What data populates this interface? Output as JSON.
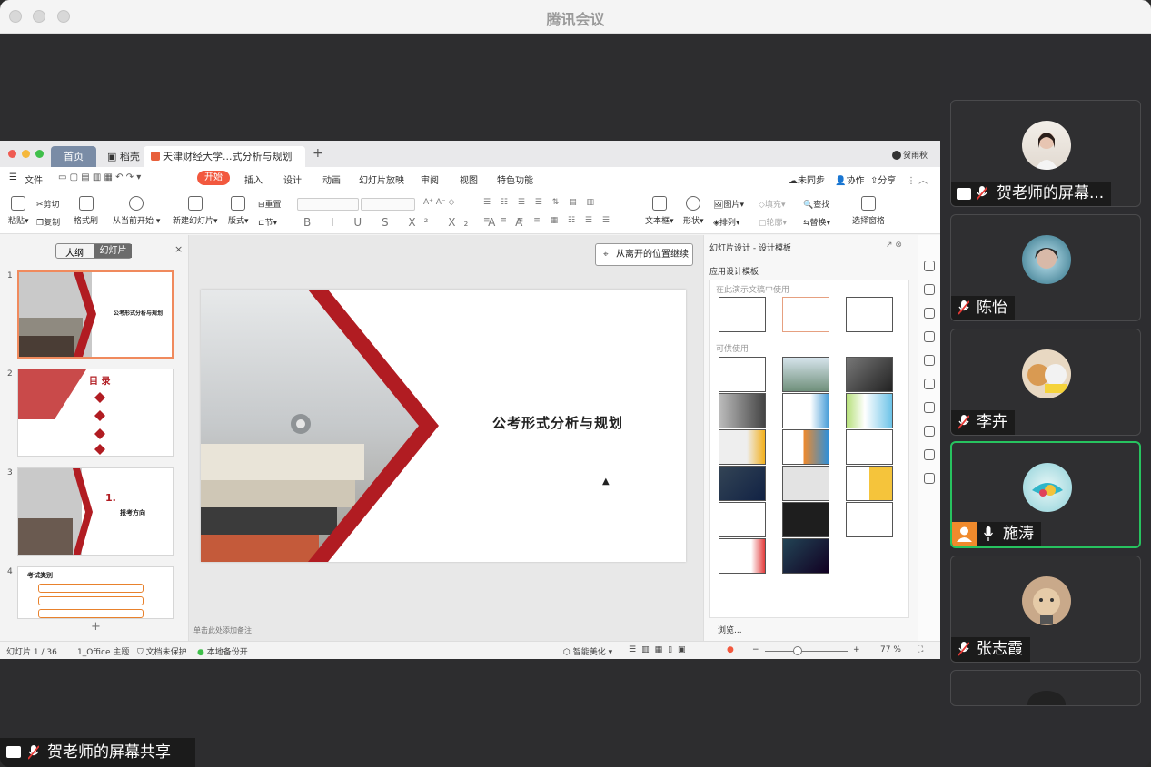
{
  "app": {
    "title": "腾讯会议"
  },
  "wps": {
    "tabs": {
      "home": "首页",
      "daoke": "稻壳",
      "doc": "天津财经大学...式分析与规划",
      "add": "+"
    },
    "user": "贺雨秋",
    "menu": {
      "file": "文件",
      "start": "开始",
      "insert": "插入",
      "design": "设计",
      "animation": "动画",
      "slideshow": "幻灯片放映",
      "review": "审阅",
      "view": "视图",
      "special": "特色功能",
      "unsynced": "未同步",
      "collab": "协作",
      "share": "分享"
    },
    "ribbon": {
      "paste": "粘贴",
      "cut": "剪切",
      "copy": "复制",
      "format_painter": "格式刷",
      "play_from_current": "从当前开始",
      "new_slide": "新建幻灯片",
      "layout": "版式",
      "reset": "重置",
      "section": "节",
      "textbox": "文本框",
      "shape": "形状",
      "picture": "图片",
      "arrange": "排列",
      "fill": "填充",
      "outline": "轮廓",
      "find": "查找",
      "replace": "替换",
      "select_pane": "选择窗格"
    },
    "left_panel": {
      "outline": "大纲",
      "slides": "幻灯片",
      "close": "×",
      "add": "+",
      "thumbs": [
        {
          "num": "1",
          "title": "公考形式分析与规划"
        },
        {
          "num": "2",
          "title": "目 录"
        },
        {
          "num": "3",
          "heading": "1.",
          "title": "报考方向"
        },
        {
          "num": "4",
          "title": "考试类别"
        }
      ]
    },
    "slide": {
      "title": "公考形式分析与规划",
      "resume": "从离开的位置继续"
    },
    "notes": "单击此处添加备注",
    "design_panel": {
      "title": "幻灯片设计 - 设计模板",
      "apply": "应用设计模板",
      "in_use": "在此演示文稿中使用",
      "available": "可供使用",
      "browse": "浏览..."
    },
    "status": {
      "slide_count": "幻灯片 1 / 36",
      "theme": "1_Office 主题",
      "unprotected": "文档未保护",
      "backup": "本地备份开",
      "beautify": "智能美化",
      "zoom": "77 %"
    }
  },
  "share_label": "贺老师的屏幕共享",
  "participants": [
    {
      "name": "贺老师的屏幕...",
      "sharing": true,
      "muted": true
    },
    {
      "name": "陈怡",
      "muted": true
    },
    {
      "name": "李卉",
      "muted": true
    },
    {
      "name": "施涛",
      "muted": false,
      "active": true
    },
    {
      "name": "张志霞",
      "muted": true
    }
  ],
  "colors": {
    "accent_green": "#27c35f",
    "wps_orange": "#f2583e",
    "slide_red": "#b11c22"
  }
}
